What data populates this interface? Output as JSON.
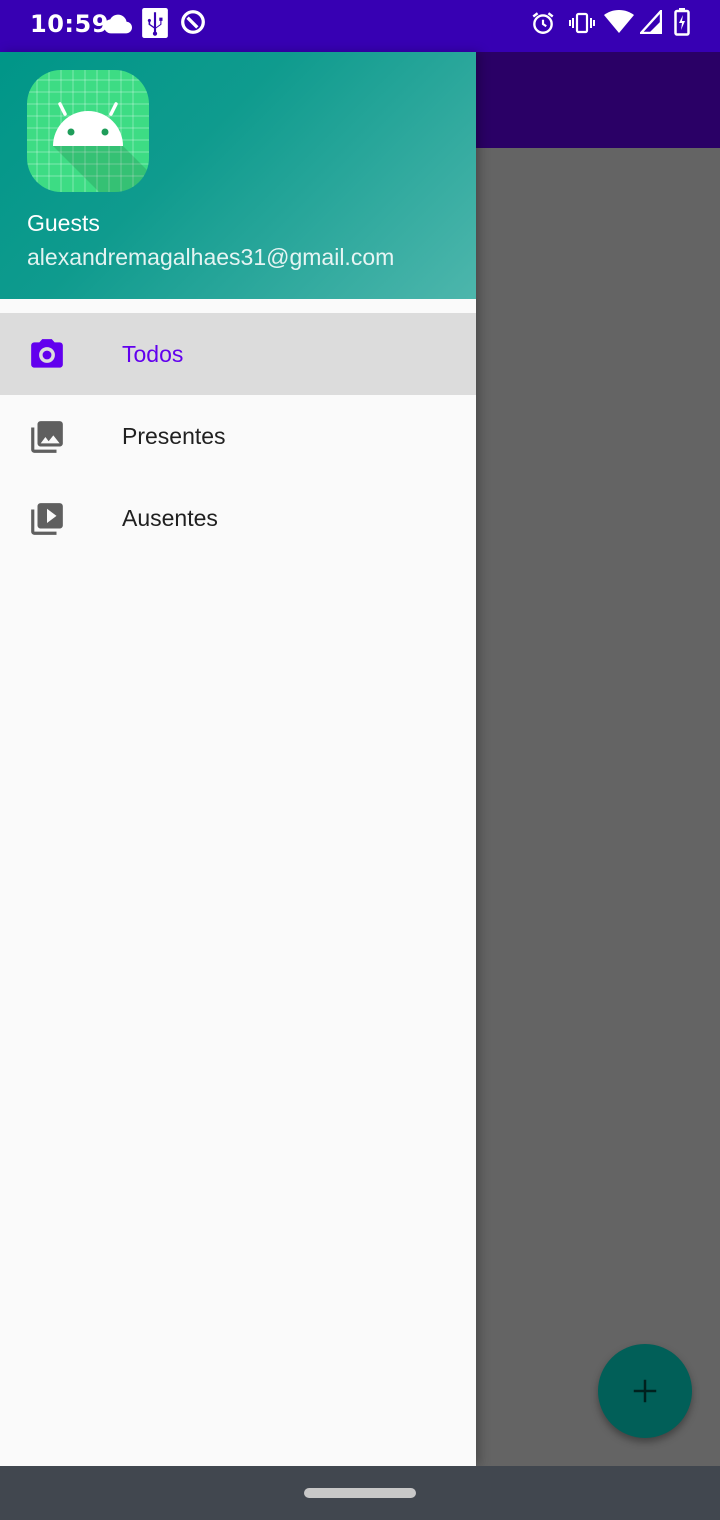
{
  "status_bar": {
    "time": "10:59",
    "left_icons": [
      "cloud-icon",
      "usb-icon",
      "data-saver-icon"
    ],
    "right_icons": [
      "alarm-icon",
      "vibrate-icon",
      "wifi-icon",
      "signal-icon",
      "battery-charging-icon"
    ]
  },
  "drawer": {
    "header": {
      "name": "Guests",
      "email": "alexandremagalhaes31@gmail.com",
      "logo_icon": "android-icon"
    },
    "items": [
      {
        "label": "Todos",
        "icon": "camera-icon",
        "active": true
      },
      {
        "label": "Presentes",
        "icon": "gallery-icon",
        "active": false
      },
      {
        "label": "Ausentes",
        "icon": "video-library-icon",
        "active": false
      }
    ]
  },
  "fab": {
    "icon": "plus-icon"
  },
  "colors": {
    "status_bar": "#3700b3",
    "toolbar": "#2a0066",
    "header_start": "#009688",
    "header_end": "#4db6ac",
    "active_text": "#6200ee",
    "fab": "#015f58"
  }
}
